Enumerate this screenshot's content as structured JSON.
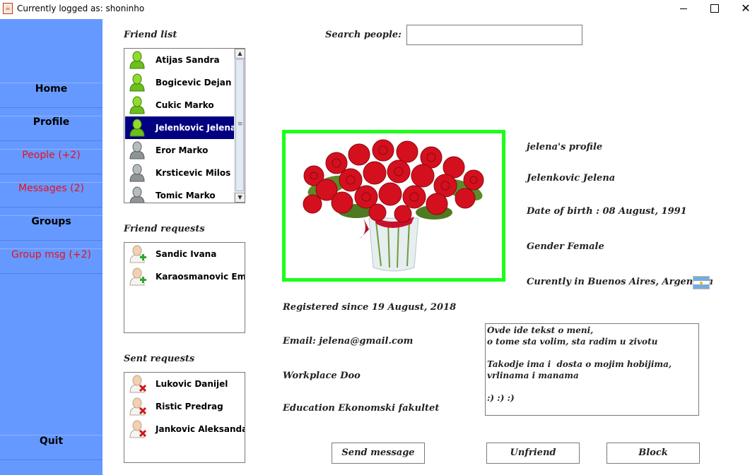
{
  "window": {
    "title": "Currently logged as: shoninho",
    "close_glyph": "✕"
  },
  "sidebar": {
    "items": [
      {
        "label": "Home"
      },
      {
        "label": "Profile"
      },
      {
        "label": "People (+2)"
      },
      {
        "label": "Messages (2)"
      },
      {
        "label": "Groups"
      },
      {
        "label": "Group msg (+2)"
      }
    ],
    "quit_label": "Quit",
    "alert_color": "#e8101e",
    "bg_color": "#6699ff"
  },
  "friend_list": {
    "title": "Friend list",
    "friends": [
      {
        "name": "Atijas Sandra",
        "status": "online"
      },
      {
        "name": "Bogicevic Dejan",
        "status": "online"
      },
      {
        "name": "Cukic Marko",
        "status": "online"
      },
      {
        "name": "Jelenkovic Jelena",
        "status": "online",
        "selected": true
      },
      {
        "name": "Eror Marko",
        "status": "offline"
      },
      {
        "name": "Krsticevic Milos",
        "status": "offline"
      },
      {
        "name": "Tomic Marko",
        "status": "offline"
      }
    ]
  },
  "friend_requests": {
    "title": "Friend requests",
    "items": [
      {
        "name": "Sandic Ivana"
      },
      {
        "name": "Karaosmanovic Emir"
      }
    ]
  },
  "sent_requests": {
    "title": "Sent requests",
    "items": [
      {
        "name": "Lukovic Danijel"
      },
      {
        "name": "Ristic Predrag"
      },
      {
        "name": "Jankovic Aleksandar"
      }
    ]
  },
  "search": {
    "label": "Search people:",
    "value": ""
  },
  "profile": {
    "heading": "jelena's profile",
    "full_name": "Jelenkovic Jelena",
    "date_of_birth": "Date of birth : 08 August, 1991",
    "gender": "Gender Female",
    "location": "Curently in Buenos Aires, Argentina",
    "registered": "Registered since 19 August, 2018",
    "email": "Email: jelena@gmail.com",
    "workplace": "Workplace Doo",
    "education": "Education Ekonomski fakultet",
    "photo_border_color": "#1aff1a",
    "bio": "Ovde ide tekst o meni,\no tome sta volim, sta radim u zivotu\n\nTakodje ima i  dosta o mojim hobijima, vrlinama i manama\n\n:) :) :)"
  },
  "actions": {
    "send_message": "Send message",
    "unfriend": "Unfriend",
    "block": "Block"
  },
  "icons": {
    "app": "java-cup-icon",
    "online": "user-online-icon",
    "offline": "user-offline-icon",
    "request": "user-add-icon",
    "sent": "user-remove-icon",
    "flag": "argentina-flag-icon"
  }
}
